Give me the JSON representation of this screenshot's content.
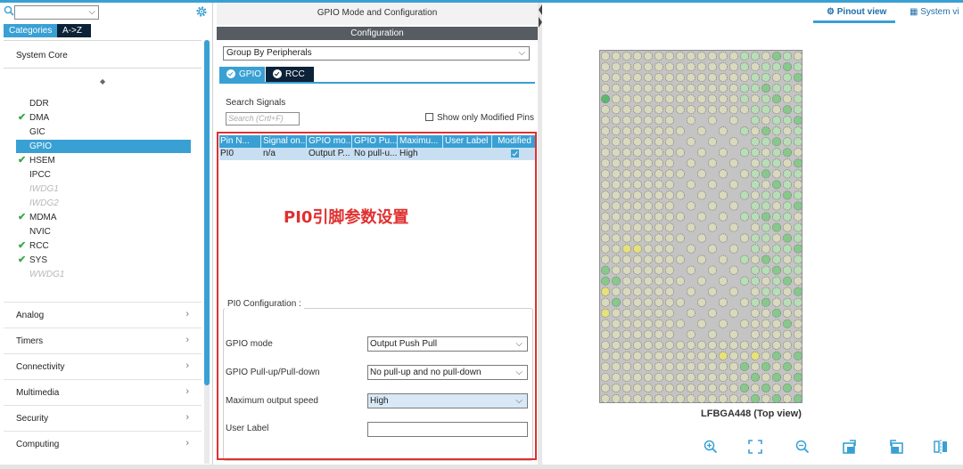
{
  "left": {
    "tabs": {
      "categories": "Categories",
      "az": "A->Z"
    },
    "section_title": "System Core",
    "peripherals": [
      {
        "label": "DDR",
        "state": "normal"
      },
      {
        "label": "DMA",
        "state": "checked"
      },
      {
        "label": "GIC",
        "state": "normal"
      },
      {
        "label": "GPIO",
        "state": "selected"
      },
      {
        "label": "HSEM",
        "state": "checked"
      },
      {
        "label": "IPCC",
        "state": "normal"
      },
      {
        "label": "IWDG1",
        "state": "disabled"
      },
      {
        "label": "IWDG2",
        "state": "disabled"
      },
      {
        "label": "MDMA",
        "state": "checked"
      },
      {
        "label": "NVIC",
        "state": "normal"
      },
      {
        "label": "RCC",
        "state": "checked"
      },
      {
        "label": "SYS",
        "state": "checked"
      },
      {
        "label": "WWDG1",
        "state": "disabled"
      }
    ],
    "groups": [
      "Analog",
      "Timers",
      "Connectivity",
      "Multimedia",
      "Security",
      "Computing"
    ]
  },
  "middle": {
    "title": "GPIO Mode and Configuration",
    "config_bar": "Configuration",
    "group_by": "Group By Peripherals",
    "tabs": {
      "gpio": "GPIO",
      "rcc": "RCC"
    },
    "search_label": "Search Signals",
    "search_placeholder": "Search (Crtl+F)",
    "only_modified": "Show only Modified Pins",
    "table": {
      "headers": [
        "Pin N...",
        "Signal on...",
        "GPIO mo...",
        "GPIO Pu...",
        "Maximu...",
        "User Label",
        "Modified"
      ],
      "row": [
        "PI0",
        "n/a",
        "Output P...",
        "No pull-u...",
        "High",
        "",
        ""
      ]
    },
    "annotation": "PI0引脚参数设置",
    "pin_config": {
      "title": "PI0 Configuration :",
      "gpio_mode_label": "GPIO mode",
      "gpio_mode_value": "Output Push Pull",
      "pull_label": "GPIO Pull-up/Pull-down",
      "pull_value": "No pull-up and no pull-down",
      "speed_label": "Maximum output speed",
      "speed_value": "High",
      "user_label_label": "User Label",
      "user_label_value": ""
    }
  },
  "right": {
    "tabs": {
      "pinout": "Pinout view",
      "system": "System vi"
    },
    "chip_label": "LFBGA448 (Top view)",
    "ball_colors": {
      "empty": "#d9d9bd",
      "green": "#86c98a",
      "light_green": "#b8deb5",
      "yellow": "#e6e17a",
      "dark_green": "#5cb870"
    }
  }
}
